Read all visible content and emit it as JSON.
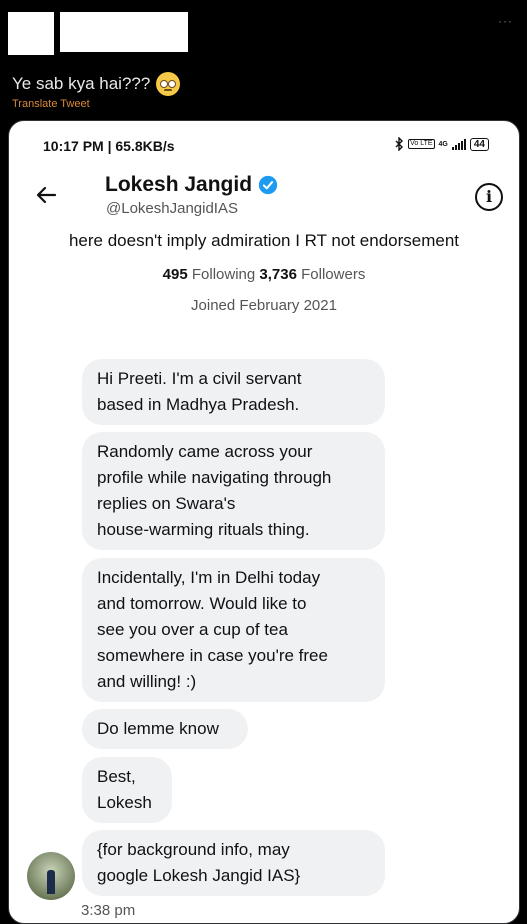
{
  "tweet": {
    "text": "Ye sab kya hai???",
    "emoji": "rolling-eyes-emoji",
    "translate_label": "Translate Tweet",
    "more_label": "···"
  },
  "screenshot": {
    "status": {
      "time": "10:17 PM | 65.8KB/s",
      "network": "4G",
      "volte": "Vo LTE",
      "battery": "44"
    },
    "profile": {
      "name": "Lokesh Jangid",
      "handle": "@LokeshJangidIAS",
      "bio": "here doesn't imply admiration I RT not endorsement",
      "following_count": "495",
      "following_label": "Following",
      "followers_count": "3,736",
      "followers_label": "Followers",
      "joined": "Joined February 2021"
    },
    "messages": [
      "Hi Preeti. I'm a civil servant\nbased in Madhya Pradesh.",
      "Randomly came across your\nprofile while navigating through\nreplies on Swara's\nhouse-warming rituals thing.",
      "Incidentally, I'm in Delhi today\nand tomorrow. Would like to\nsee you over a cup of tea\nsomewhere in case you're free\nand willing! :)",
      "Do lemme know",
      "Best,\nLokesh",
      "{for background info, may\ngoogle Lokesh Jangid IAS}"
    ],
    "timestamp": "3:38 pm"
  },
  "colors": {
    "background": "#000000",
    "verified": "#1d9bf0",
    "translate": "#d98a3d",
    "bubble": "#eff1f3"
  }
}
